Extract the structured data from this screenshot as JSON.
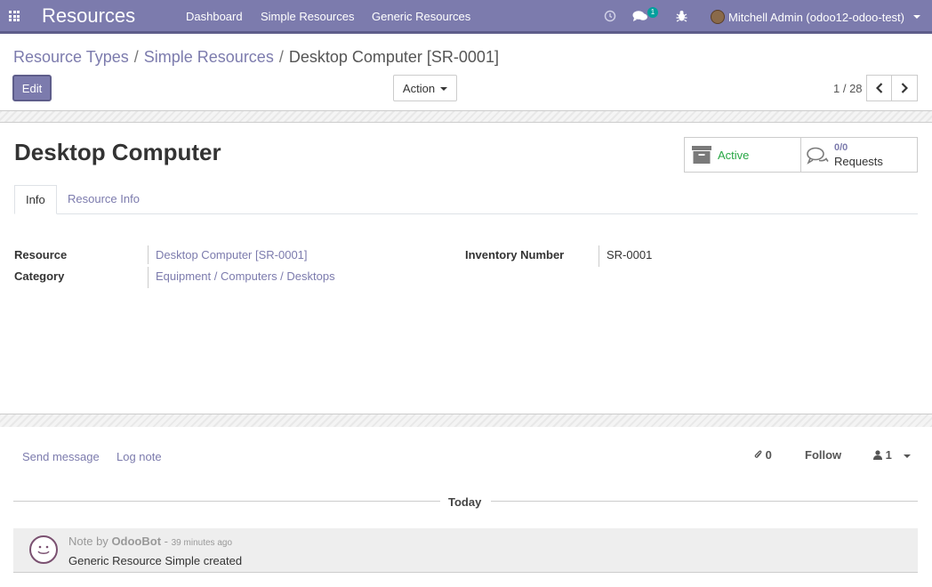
{
  "navbar": {
    "brand": "Resources",
    "menus": [
      "Dashboard",
      "Simple Resources",
      "Generic Resources"
    ],
    "messages_badge": "1",
    "user": "Mitchell Admin (odoo12-odoo-test)"
  },
  "breadcrumb": {
    "items": [
      "Resource Types",
      "Simple Resources"
    ],
    "current": "Desktop Computer [SR-0001]",
    "separator": "/"
  },
  "controls": {
    "edit_label": "Edit",
    "action_label": "Action",
    "pager": "1 / 28"
  },
  "record": {
    "title": "Desktop Computer",
    "stat_active": "Active",
    "stat_requests_count": "0/0",
    "stat_requests_label": "Requests"
  },
  "tabs": [
    "Info",
    "Resource Info"
  ],
  "fields": {
    "resource_label": "Resource",
    "resource_value": "Desktop Computer [SR-0001]",
    "category_label": "Category",
    "category_value": "Equipment / Computers / Desktops",
    "inventory_label": "Inventory Number",
    "inventory_value": "SR-0001"
  },
  "chatter": {
    "send_message": "Send message",
    "log_note": "Log note",
    "attachments": "0",
    "follow": "Follow",
    "followers": "1",
    "date_separator": "Today",
    "message": {
      "type": "Note by",
      "author": "OdooBot",
      "dash": "-",
      "time": "39 minutes ago",
      "body": "Generic Resource Simple created"
    }
  },
  "colors": {
    "brand": "#7c7bad",
    "active_green": "#28a745"
  }
}
